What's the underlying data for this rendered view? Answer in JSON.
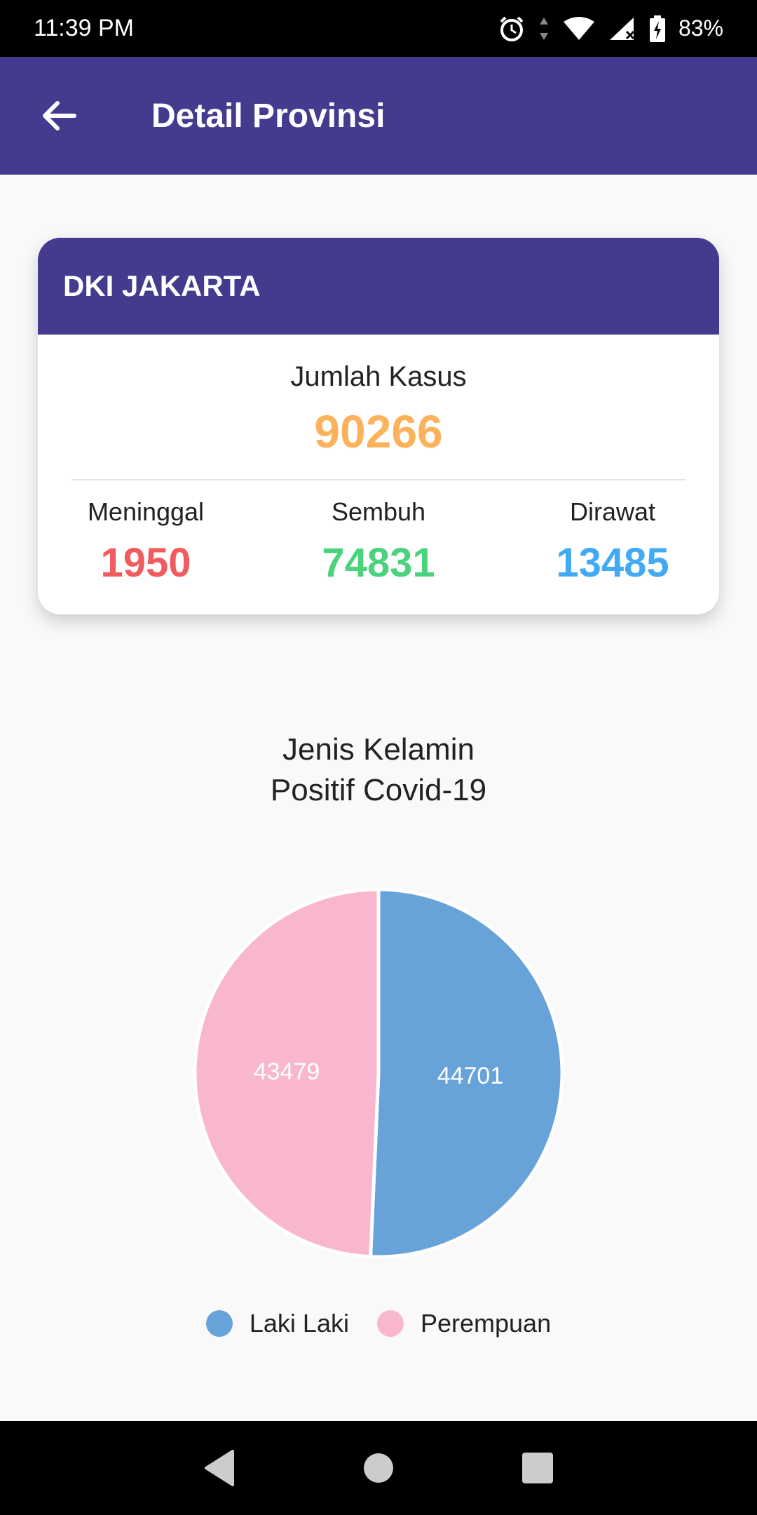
{
  "status_bar": {
    "time": "11:39 PM",
    "battery": "83%"
  },
  "app_bar": {
    "title": "Detail Provinsi"
  },
  "province": {
    "name": "DKI JAKARTA",
    "total_label": "Jumlah Kasus",
    "total_value": "90266",
    "stats": [
      {
        "label": "Meninggal",
        "value": "1950",
        "color": "#f15b5d"
      },
      {
        "label": "Sembuh",
        "value": "74831",
        "color": "#4bd27d"
      },
      {
        "label": "Dirawat",
        "value": "13485",
        "color": "#42aaf5"
      }
    ]
  },
  "colors": {
    "primary": "#443b8e",
    "total": "#fcb25a",
    "male": "#67a3d9",
    "female": "#f8b7ce"
  },
  "chart_data": {
    "type": "pie",
    "title": "Jenis Kelamin\nPositif Covid-19",
    "categories": [
      "Laki Laki",
      "Perempuan"
    ],
    "values": [
      44701,
      43479
    ],
    "colors": [
      "#67a3d9",
      "#f8b7ce"
    ],
    "show_values": true,
    "legend": "bottom-center"
  },
  "icons": {
    "back": "arrow-left-icon",
    "alarm": "alarm-icon",
    "wifi": "wifi-icon",
    "signal": "signal-icon",
    "battery": "battery-charging-icon",
    "nav_back": "nav-back-icon",
    "nav_home": "nav-home-icon",
    "nav_recents": "nav-recents-icon"
  }
}
